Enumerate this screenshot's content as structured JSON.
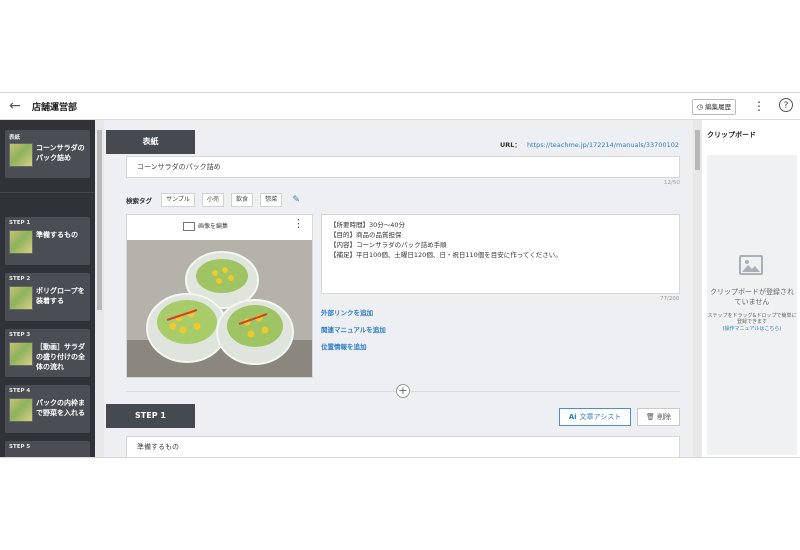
{
  "header": {
    "back_icon": "arrow-left-icon",
    "title": "店舗運営部",
    "history_label": "編集履歴",
    "more_icon": "kebab-menu-icon",
    "help_label": "?"
  },
  "sidebar": {
    "items": [
      {
        "label": "表紙",
        "text": "コーンサラダのパック詰め"
      },
      {
        "label": "STEP 1",
        "text": "準備するもの"
      },
      {
        "label": "STEP 2",
        "text": "ポリグロープを装着する"
      },
      {
        "label": "STEP 3",
        "text": "［動画］サラダの盛り付けの全体の流れ"
      },
      {
        "label": "STEP 4",
        "text": "パックの内枠まで野菜を入れる"
      },
      {
        "label": "STEP 5",
        "text": ""
      }
    ]
  },
  "main": {
    "cover_tab": "表紙",
    "url_label": "URL：",
    "url_value": "https://teachme.jp/172214/manuals/33700102",
    "title_value": "コーンサラダのパック詰め",
    "title_counter": "12/50",
    "tags_label": "検索タグ",
    "tags": [
      "サンプル",
      "小売",
      "飲食",
      "惣菜"
    ],
    "image_edit_label": "画像を編集",
    "description_lines": [
      "【所要時間】30分〜40分",
      "【目的】商品の品質担保",
      "【内容】コーンサラダのパック詰め手順",
      "【補足】平日100個、土曜日120個、日・祝日110個を目安に作ってください。"
    ],
    "description_counter": "77/200",
    "links": [
      "外部リンクを追加",
      "関連マニュアルを追加",
      "位置情報を追加"
    ],
    "step_tab": "STEP 1",
    "assist_ai": "Ai",
    "assist_label": "文章アシスト",
    "delete_label": "削除",
    "step_title_value": "準備するもの"
  },
  "clipboard": {
    "title": "クリップボード",
    "empty_line1": "クリップボードが登録されていません",
    "empty_line2": "ステップをドラッグ&ドロップで簡単に登録できます",
    "empty_link": "(操作マニュアルはこちら)"
  },
  "colors": {
    "sidebar_bg": "#2f3237",
    "tab_bg": "#454a51",
    "link": "#2d7cc8",
    "content_bg": "#edeff2"
  }
}
